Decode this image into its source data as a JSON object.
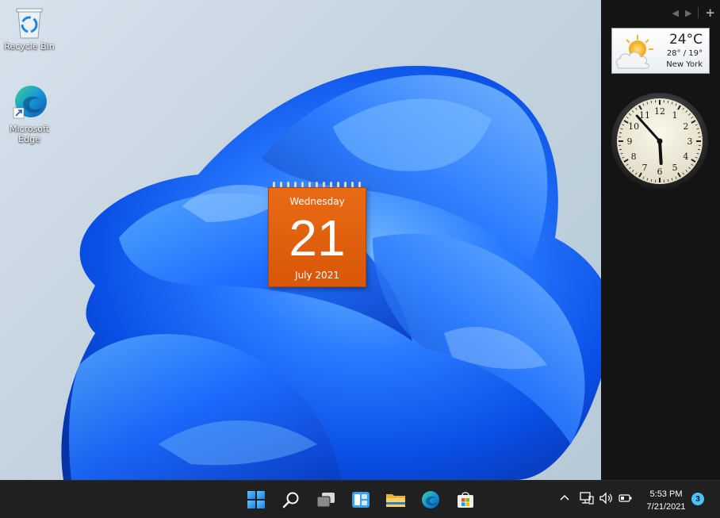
{
  "desktop": {
    "icons": [
      {
        "label": "Recycle Bin",
        "icon": "recycle-bin-icon"
      },
      {
        "label": "Microsoft Edge",
        "icon": "edge-icon"
      }
    ]
  },
  "calendar_gadget": {
    "weekday": "Wednesday",
    "day": "21",
    "month_year": "July 2021",
    "color": "#e2600e"
  },
  "sidebar": {
    "controls": [
      "previous-icon",
      "next-icon",
      "add-gadget-icon"
    ],
    "weather": {
      "temperature": "24°C",
      "range": "28° / 19°",
      "city": "New York",
      "icon": "partly-cloudy-icon"
    },
    "clock": {
      "hour": 5,
      "minute": 53,
      "numerals": [
        "12",
        "1",
        "2",
        "3",
        "4",
        "5",
        "6",
        "7",
        "8",
        "9",
        "10",
        "11"
      ]
    }
  },
  "taskbar": {
    "pinned": [
      {
        "name": "start",
        "icon": "windows-start-icon"
      },
      {
        "name": "search",
        "icon": "search-icon"
      },
      {
        "name": "task-view",
        "icon": "task-view-icon"
      },
      {
        "name": "widgets",
        "icon": "widgets-icon"
      },
      {
        "name": "file-explorer",
        "icon": "folder-icon"
      },
      {
        "name": "edge",
        "icon": "edge-icon"
      },
      {
        "name": "store",
        "icon": "store-icon"
      }
    ],
    "tray": {
      "time": "5:53 PM",
      "date": "7/21/2021",
      "notifications": "3"
    }
  },
  "colors": {
    "accent": "#0078d4",
    "taskbar": "#202020",
    "sidebar": "#141414",
    "badge": "#4cc2ff"
  }
}
